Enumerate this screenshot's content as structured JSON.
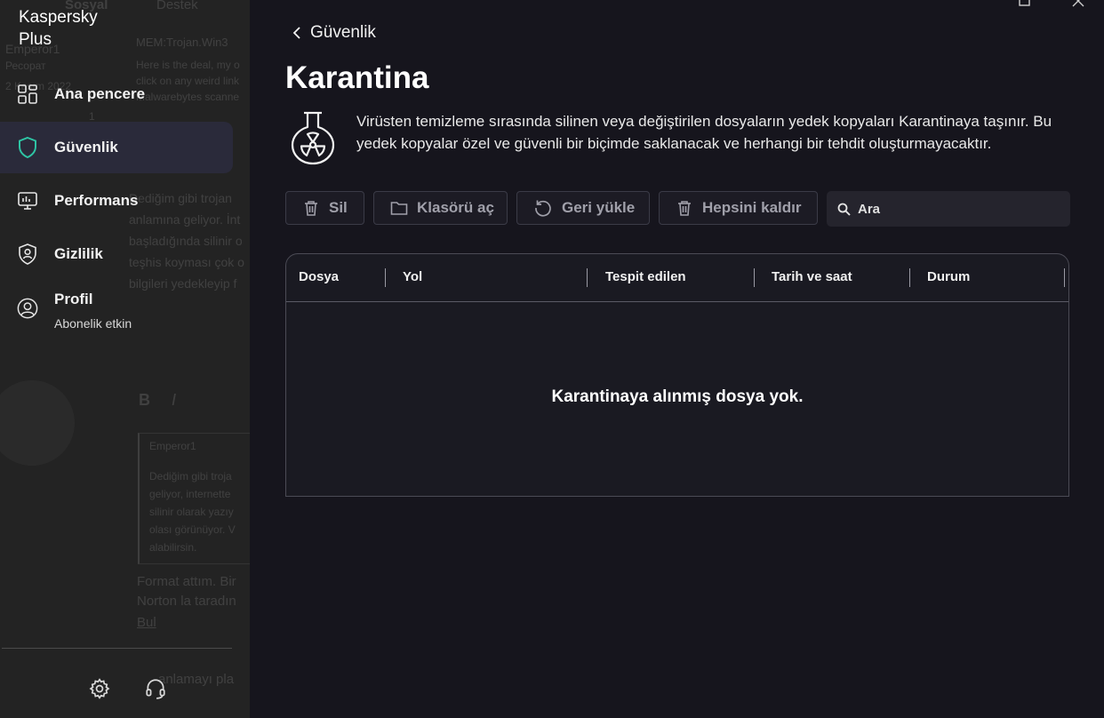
{
  "app": {
    "brand_line1": "Kaspersky",
    "brand_line2": "Plus"
  },
  "background_ghost": {
    "tab1": "Sosyal",
    "tab2": "Destek",
    "user": "Emperor1",
    "role": "Ресорат",
    "date": "2 Kasım 2022",
    "count": "1",
    "thread_title": "MEM:Trojan.Win3",
    "post_line1": "Here is the deal, my o",
    "post_line2": "click on any weird link",
    "post_line3": "Malwarebytes scanne",
    "body_line1": "Dediğim gibi trojan",
    "body_line2": "anlamına geliyor. İnt",
    "body_line3": "başladığında silinir o",
    "body_line4": "teşhis koyması çok o",
    "body_line5": "bilgileri yedekleyip f",
    "editor_b": "B",
    "editor_i": "I",
    "quote_user": "Emperor1",
    "quote_line1": "Dediğim gibi troja",
    "quote_line2": "geliyor, internette",
    "quote_line3": "silinir olarak yazıy",
    "quote_line4": "olası görünüyor. V",
    "quote_line5": "alabilirsin.",
    "reply_line1": "Format attım. Bir",
    "reply_line2": "Norton la taradın",
    "reply_line3": "Bul",
    "footer_line": "anlamayı pla"
  },
  "sidebar": {
    "items": [
      {
        "label": "Ana pencere",
        "icon": "dashboard-icon"
      },
      {
        "label": "Güvenlik",
        "icon": "shield-icon"
      },
      {
        "label": "Performans",
        "icon": "monitor-icon"
      },
      {
        "label": "Gizlilik",
        "icon": "privacy-shield-icon"
      },
      {
        "label": "Profil",
        "sublabel": "Abonelik etkin",
        "icon": "profile-icon"
      }
    ],
    "active_index": 1,
    "bottom_icons": [
      "gear-icon",
      "headset-icon"
    ]
  },
  "header": {
    "back_label": "Güvenlik",
    "title": "Karantina",
    "description": "Virüsten temizleme sırasında silinen veya değiştirilen dosyaların yedek kopyaları Karantinaya taşınır. Bu yedek kopyalar özel ve güvenli bir biçimde saklanacak ve herhangi bir tehdit oluşturmayacaktır."
  },
  "toolbar": {
    "delete_label": "Sil",
    "open_folder_label": "Klasörü aç",
    "restore_label": "Geri yükle",
    "remove_all_label": "Hepsini kaldır",
    "search_placeholder": "Ara"
  },
  "table": {
    "columns": [
      "Dosya",
      "Yol",
      "Tespit edilen",
      "Tarih ve saat",
      "Durum"
    ],
    "rows": [],
    "empty_message": "Karantinaya alınmış dosya yok."
  },
  "colors": {
    "accent_green": "#2ec4a4",
    "background": "#16151d",
    "sidebar": "#232323"
  }
}
